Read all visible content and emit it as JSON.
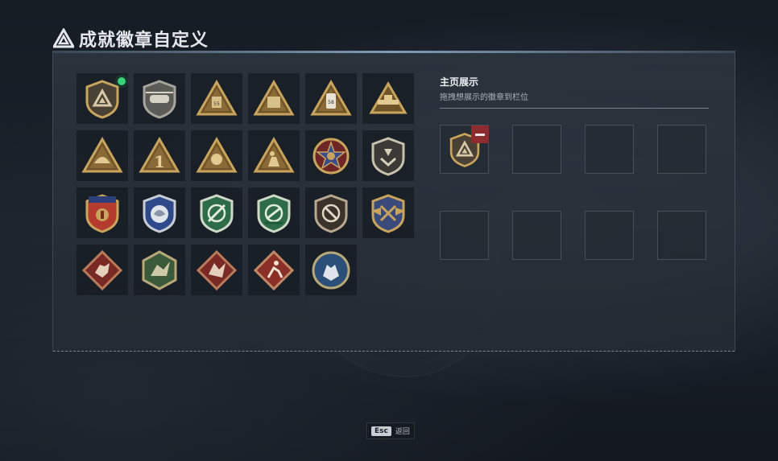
{
  "header": {
    "title": "成就徽章自定义",
    "logo_icon": "triangle-emblem-icon"
  },
  "badges": [
    {
      "icon": "shield-triangle-badge-icon",
      "equipped": true
    },
    {
      "icon": "helicopter-badge-icon"
    },
    {
      "icon": "jerrycan-55-badge-icon"
    },
    {
      "icon": "ammo-box-badge-icon"
    },
    {
      "icon": "phone-58-badge-icon"
    },
    {
      "icon": "turret-badge-icon"
    },
    {
      "icon": "helmet-badge-icon"
    },
    {
      "icon": "number-one-badge-icon"
    },
    {
      "icon": "tank-crest-badge-icon"
    },
    {
      "icon": "soldier-badge-icon"
    },
    {
      "icon": "star-medal-badge-icon"
    },
    {
      "icon": "chevron-shield-badge-icon"
    },
    {
      "icon": "gold-stars-crest-badge-icon"
    },
    {
      "icon": "silver-eagle-crest-badge-icon"
    },
    {
      "icon": "green-crosshair-shield-badge-icon"
    },
    {
      "icon": "green-rifle-shield-badge-icon"
    },
    {
      "icon": "bronze-slash-shield-badge-icon"
    },
    {
      "icon": "winged-crossed-rifles-badge-icon"
    },
    {
      "icon": "red-wolf-diamond-badge-icon"
    },
    {
      "icon": "green-dragon-hexagon-badge-icon"
    },
    {
      "icon": "red-dragon-diamond-badge-icon"
    },
    {
      "icon": "runner-diamond-badge-icon"
    },
    {
      "icon": "blue-wolf-round-badge-icon"
    }
  ],
  "showcase": {
    "title": "主页展示",
    "subtitle": "拖拽想展示的徽章到栏位",
    "slots": [
      {
        "icon": "shield-triangle-badge-icon",
        "filled": true
      },
      {
        "filled": false
      },
      {
        "filled": false
      },
      {
        "filled": false
      },
      {
        "filled": false
      },
      {
        "filled": false
      },
      {
        "filled": false
      },
      {
        "filled": false
      }
    ]
  },
  "footer": {
    "key": "Esc",
    "label": "返回"
  },
  "colors": {
    "accent_green": "#37d37a",
    "remove_red": "#8e2b2e",
    "gold": "#c9a45c"
  }
}
